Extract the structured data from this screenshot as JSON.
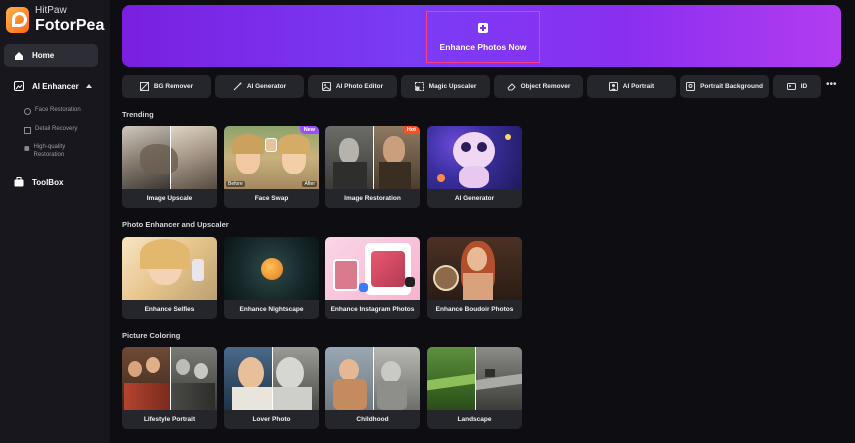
{
  "brand": {
    "small": "HitPaw",
    "big": "FotorPea"
  },
  "sidebar": {
    "home": "Home",
    "ai_enhancer": "AI Enhancer",
    "sub_items": [
      "Face Restoration",
      "Detail Recovery",
      "High-quality Restoration"
    ],
    "toolbox": "ToolBox"
  },
  "hero": {
    "cta": "Enhance Photos Now"
  },
  "tools": [
    "BG Remover",
    "AI Generator",
    "AI Photo Editor",
    "Magic Upscaler",
    "Object Remover",
    "AI Portrait",
    "Portrait Background",
    "ID"
  ],
  "sections": {
    "trending": {
      "title": "Trending",
      "cards": [
        "Image Upscale",
        "Face Swap",
        "Image Restoration",
        "AI Generator"
      ],
      "badges": {
        "face_swap": "New",
        "restoration": "Hot"
      },
      "before": "Before",
      "after": "After"
    },
    "enhancer": {
      "title": "Photo Enhancer and Upscaler",
      "cards": [
        "Enhance Selfies",
        "Enhance Nightscape",
        "Enhance Instagram Photos",
        "Enhance Boudoir Photos"
      ]
    },
    "coloring": {
      "title": "Picture Coloring",
      "cards": [
        "Lifestyle Portrait",
        "Lover Photo",
        "Childhood",
        "Landscape"
      ]
    }
  },
  "colors": {
    "accent": "#7a30ee",
    "cta_border": "#ff3d7f",
    "new_badge": "#9b4dff",
    "hot_badge": "#ff4d1f"
  }
}
